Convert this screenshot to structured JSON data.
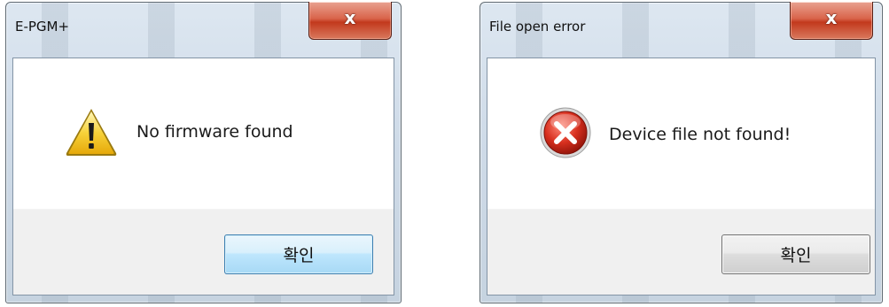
{
  "dialogs": [
    {
      "title": "E-PGM+",
      "close_label": "x",
      "icon": "warning-icon",
      "message": "No firmware found",
      "ok_label": "확인"
    },
    {
      "title": "File open error",
      "close_label": "x",
      "icon": "error-icon",
      "message": "Device file not found!",
      "ok_label": "확인"
    }
  ],
  "colors": {
    "close_button": "#c2391d",
    "ok_button_focused": "#a7d9f5",
    "error_red": "#c8231e",
    "warning_yellow": "#f2c31a"
  }
}
